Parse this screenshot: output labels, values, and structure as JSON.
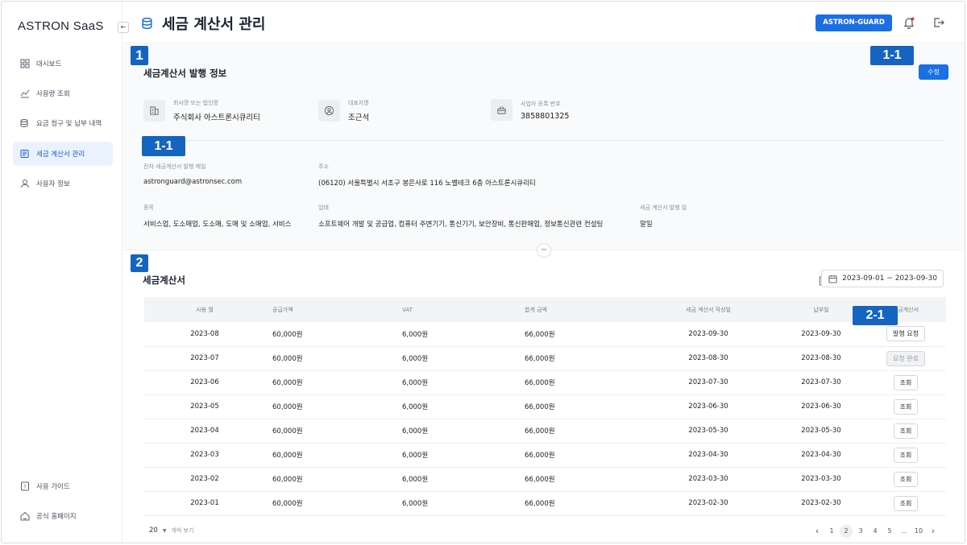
{
  "app": {
    "logo": "ASTRON SaaS",
    "collapse_icon": "⇤"
  },
  "sidebar": {
    "items": [
      {
        "label": "대시보드",
        "icon": "grid-icon"
      },
      {
        "label": "사용량 조회",
        "icon": "chart-icon"
      },
      {
        "label": "요금 청구 및 납부 내역",
        "icon": "coins-icon"
      },
      {
        "label": "세금 계산서 관리",
        "icon": "invoice-icon",
        "active": true
      },
      {
        "label": "사용자 정보",
        "icon": "user-icon"
      }
    ],
    "bottom": [
      {
        "label": "사용 가이드",
        "icon": "guide-icon"
      },
      {
        "label": "공식 홈페이지",
        "icon": "home-icon"
      }
    ]
  },
  "header": {
    "title": "세금 계산서 관리",
    "account_button": "ASTRON-GUARD"
  },
  "markers": {
    "m1": "1",
    "m1_1a": "1-1",
    "m1_1b": "1-1",
    "m2": "2",
    "m2_1": "2-1"
  },
  "issue_info": {
    "title": "세금계산서 발행 정보",
    "edit_button": "수정",
    "company_label": "회사명 또는 법인명",
    "company_value": "주식회사 아스트론시큐리티",
    "ceo_label": "대표자명",
    "ceo_value": "조근석",
    "bizno_label": "사업자 등록 번호",
    "bizno_value": "3858801325",
    "email_label": "전자 세금계산서 발행 메일",
    "email_value": "astronguard@astronsec.com",
    "address_label": "주소",
    "address_value": "(06120) 서울특별시 서초구 봉은사로 116 노벨테크 6층 아스트론시큐리티",
    "type_label": "종목",
    "type_value": "서비스업, 도소매업, 도소매, 도매 및 소매업, 서비스",
    "business_label": "업태",
    "business_value": "소프트웨어 개발 및 공급업, 컴퓨터 주변기기, 통신기기, 보안장비, 통신판매업, 정보통신관련 컨설팅",
    "issue_day_label": "세금 계산서 발행 일",
    "issue_day_value": "말일",
    "fold_icon": "−"
  },
  "invoices": {
    "title": "세금계산서",
    "date_range": "2023-09-01 ~ 2023-09-30",
    "columns": [
      "사용 월",
      "공급가액",
      "VAT",
      "합계 금액",
      "세금 계산서 작성일",
      "납부일",
      "세금계산서"
    ],
    "rows": [
      {
        "month": "2023-08",
        "supply": "60,000원",
        "vat": "6,000원",
        "total": "66,000원",
        "written": "2023-09-30",
        "paid": "2023-09-30",
        "action": "발행 요청",
        "disabled": false
      },
      {
        "month": "2023-07",
        "supply": "60,000원",
        "vat": "6,000원",
        "total": "66,000원",
        "written": "2023-08-30",
        "paid": "2023-08-30",
        "action": "요청 완료",
        "disabled": true
      },
      {
        "month": "2023-06",
        "supply": "60,000원",
        "vat": "6,000원",
        "total": "66,000원",
        "written": "2023-07-30",
        "paid": "2023-07-30",
        "action": "조회",
        "disabled": false
      },
      {
        "month": "2023-05",
        "supply": "60,000원",
        "vat": "6,000원",
        "total": "66,000원",
        "written": "2023-06-30",
        "paid": "2023-06-30",
        "action": "조회",
        "disabled": false
      },
      {
        "month": "2023-04",
        "supply": "60,000원",
        "vat": "6,000원",
        "total": "66,000원",
        "written": "2023-05-30",
        "paid": "2023-05-30",
        "action": "조회",
        "disabled": false
      },
      {
        "month": "2023-03",
        "supply": "60,000원",
        "vat": "6,000원",
        "total": "66,000원",
        "written": "2023-04-30",
        "paid": "2023-04-30",
        "action": "조회",
        "disabled": false
      },
      {
        "month": "2023-02",
        "supply": "60,000원",
        "vat": "6,000원",
        "total": "66,000원",
        "written": "2023-03-30",
        "paid": "2023-03-30",
        "action": "조회",
        "disabled": false
      },
      {
        "month": "2023-01",
        "supply": "60,000원",
        "vat": "6,000원",
        "total": "66,000원",
        "written": "2023-02-30",
        "paid": "2023-02-30",
        "action": "조회",
        "disabled": false
      }
    ],
    "page_size": "20",
    "page_size_hint": "개씩 보기",
    "pager": {
      "prev": "‹",
      "pages": [
        "1",
        "2",
        "3",
        "4",
        "5",
        "...",
        "10"
      ],
      "current": "2",
      "next": "›"
    }
  },
  "colors": {
    "accent": "#1a6fe3",
    "marker": "#1565c0",
    "active_bg": "#e9f2fd"
  }
}
